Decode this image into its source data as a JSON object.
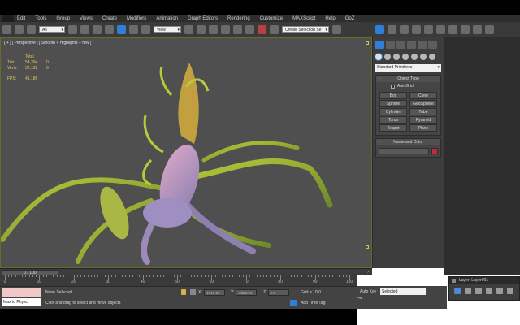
{
  "menu": {
    "items": [
      "Edit",
      "Tools",
      "Group",
      "Views",
      "Create",
      "Modifiers",
      "Animation",
      "Graph Editors",
      "Rendering",
      "Customize",
      "MAXScript",
      "Help",
      "GoZ"
    ]
  },
  "toolbar": {
    "selection_filter": "All",
    "ref_coord": "View",
    "named_selection": "Create Selection Se"
  },
  "viewport": {
    "label": "[ + ] [ Perspective ] [ Smooth + Highlights + HW ]",
    "stats": {
      "total_label": "Total",
      "tris_label": "Tris:",
      "tris_total": "54,394",
      "tris_sel": "0",
      "verts_label": "Verts:",
      "verts_total": "32,122",
      "verts_sel": "0",
      "fps_label": "FPS:",
      "fps_value": "41.186"
    }
  },
  "command_panel": {
    "category": "Standard Primitives",
    "object_type_title": "Object Type",
    "autogrid_label": "AutoGrid",
    "primitives": [
      "Box",
      "Cone",
      "Sphere",
      "GeoSphere",
      "Cylinder",
      "Tube",
      "Torus",
      "Pyramid",
      "Teapot",
      "Plane"
    ],
    "name_color_title": "Name and Color",
    "object_color": "#c0283e"
  },
  "timeline": {
    "frame_display": "0 / 100",
    "ticks": [
      "0",
      "10",
      "20",
      "30",
      "40",
      "50",
      "60",
      "70",
      "80",
      "90",
      "100"
    ]
  },
  "status": {
    "maxscript_output": "Max to Physc",
    "selection": "None Selected",
    "prompt": "Click and drag to select and move objects",
    "x_label": "X:",
    "x_value": "-1543.52",
    "y_label": "Y:",
    "y_value": "-3883.94",
    "z_label": "Z:",
    "z_value": "0.0",
    "grid": "Grid = 10.0",
    "add_time_tag": "Add Time Tag",
    "auto_key": "Auto Key",
    "key_filter": "Selected"
  },
  "layer_window": {
    "title": "Layer: Layer001"
  }
}
